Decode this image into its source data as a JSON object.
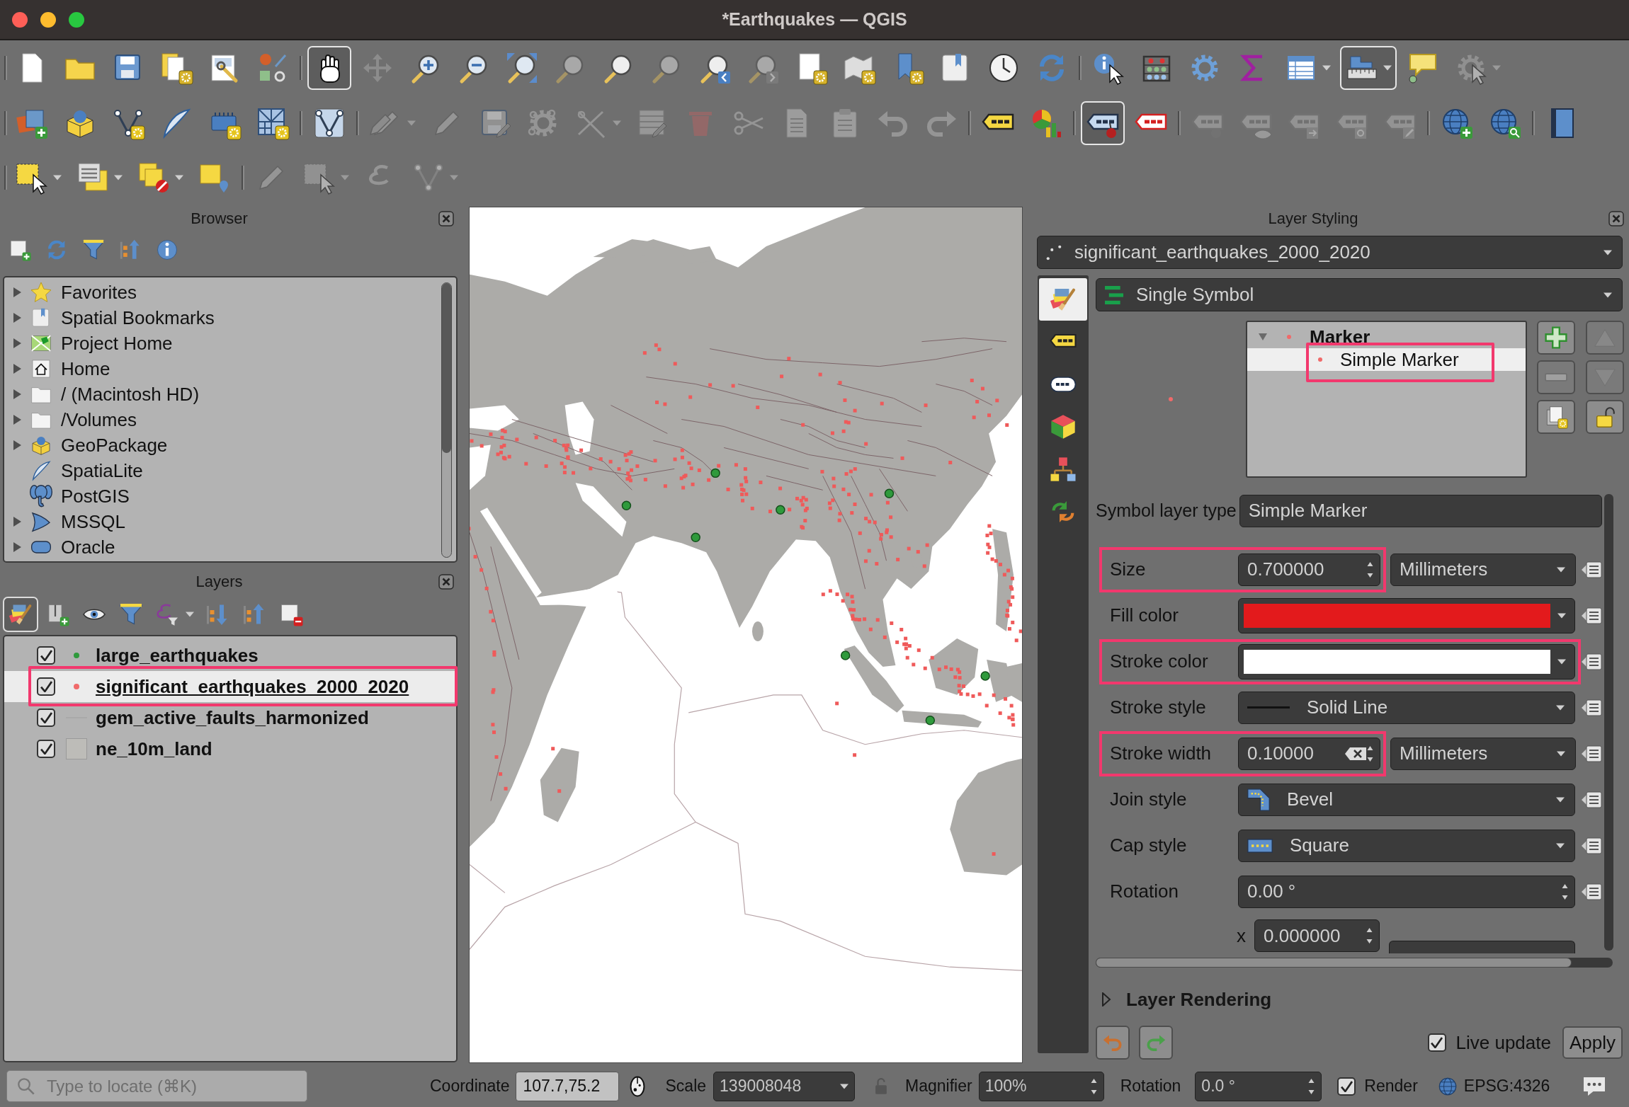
{
  "window": {
    "title": "*Earthquakes — QGIS"
  },
  "toolbars": [
    [
      [
        {
          "pressed": false,
          "disabled": false,
          "dropdown": false
        },
        {
          "pressed": false,
          "disabled": false,
          "dropdown": false
        },
        {
          "pressed": false,
          "disabled": false,
          "dropdown": false
        },
        {
          "pressed": false,
          "disabled": false,
          "dropdown": false
        },
        {
          "pressed": false,
          "disabled": false,
          "dropdown": false
        },
        {
          "pressed": false,
          "disabled": false,
          "dropdown": false
        }
      ],
      [
        {
          "pressed": true,
          "disabled": false,
          "dropdown": false
        },
        {
          "pressed": false,
          "disabled": true,
          "dropdown": false
        },
        {
          "pressed": false,
          "disabled": false,
          "dropdown": false
        },
        {
          "pressed": false,
          "disabled": false,
          "dropdown": false
        },
        {
          "pressed": false,
          "disabled": false,
          "dropdown": false
        },
        {
          "pressed": false,
          "disabled": true,
          "dropdown": false
        },
        {
          "pressed": false,
          "disabled": false,
          "dropdown": false
        },
        {
          "pressed": false,
          "disabled": true,
          "dropdown": false
        },
        {
          "pressed": false,
          "disabled": false,
          "dropdown": false
        },
        {
          "pressed": false,
          "disabled": true,
          "dropdown": false
        },
        {
          "pressed": false,
          "disabled": false,
          "dropdown": false
        },
        {
          "pressed": false,
          "disabled": false,
          "dropdown": false
        },
        {
          "pressed": false,
          "disabled": false,
          "dropdown": false
        },
        {
          "pressed": false,
          "disabled": false,
          "dropdown": false
        },
        {
          "pressed": false,
          "disabled": false,
          "dropdown": false
        },
        {
          "pressed": false,
          "disabled": false,
          "dropdown": false
        }
      ],
      [
        {
          "pressed": false,
          "disabled": false,
          "dropdown": false
        },
        {
          "pressed": false,
          "disabled": false,
          "dropdown": false
        },
        {
          "pressed": false,
          "disabled": false,
          "dropdown": false
        },
        {
          "pressed": false,
          "disabled": false,
          "dropdown": false
        },
        {
          "pressed": false,
          "disabled": false,
          "dropdown": true
        },
        {
          "pressed": true,
          "disabled": false,
          "dropdown": true
        },
        {
          "pressed": false,
          "disabled": false,
          "dropdown": false
        },
        {
          "pressed": false,
          "disabled": true,
          "dropdown": true
        }
      ]
    ],
    [
      [
        {
          "pressed": false,
          "disabled": false,
          "dropdown": false
        },
        {
          "pressed": false,
          "disabled": false,
          "dropdown": false
        },
        {
          "pressed": false,
          "disabled": false,
          "dropdown": false
        },
        {
          "pressed": false,
          "disabled": false,
          "dropdown": false
        },
        {
          "pressed": false,
          "disabled": false,
          "dropdown": false
        },
        {
          "pressed": false,
          "disabled": false,
          "dropdown": false
        }
      ],
      [
        {
          "pressed": false,
          "disabled": false,
          "dropdown": false
        }
      ],
      [
        {
          "pressed": false,
          "disabled": true,
          "dropdown": true
        },
        {
          "pressed": false,
          "disabled": true,
          "dropdown": false
        },
        {
          "pressed": false,
          "disabled": true,
          "dropdown": false
        },
        {
          "pressed": false,
          "disabled": true,
          "dropdown": false
        },
        {
          "pressed": false,
          "disabled": true,
          "dropdown": true
        },
        {
          "pressed": false,
          "disabled": true,
          "dropdown": false
        },
        {
          "pressed": false,
          "disabled": true,
          "dropdown": false
        },
        {
          "pressed": false,
          "disabled": true,
          "dropdown": false
        },
        {
          "pressed": false,
          "disabled": true,
          "dropdown": false
        },
        {
          "pressed": false,
          "disabled": true,
          "dropdown": false
        },
        {
          "pressed": false,
          "disabled": true,
          "dropdown": false
        },
        {
          "pressed": false,
          "disabled": true,
          "dropdown": false
        }
      ],
      [
        {
          "pressed": false,
          "disabled": false,
          "dropdown": false
        },
        {
          "pressed": false,
          "disabled": false,
          "dropdown": false
        }
      ],
      [
        {
          "pressed": true,
          "disabled": false,
          "dropdown": false
        },
        {
          "pressed": false,
          "disabled": false,
          "dropdown": false
        }
      ],
      [
        {
          "pressed": false,
          "disabled": true,
          "dropdown": false
        },
        {
          "pressed": false,
          "disabled": true,
          "dropdown": false
        },
        {
          "pressed": false,
          "disabled": true,
          "dropdown": false
        },
        {
          "pressed": false,
          "disabled": true,
          "dropdown": false
        },
        {
          "pressed": false,
          "disabled": true,
          "dropdown": false
        }
      ],
      [
        {
          "pressed": false,
          "disabled": false,
          "dropdown": false
        },
        {
          "pressed": false,
          "disabled": false,
          "dropdown": false
        }
      ],
      [
        {
          "pressed": false,
          "disabled": false,
          "dropdown": false
        }
      ]
    ],
    [
      [
        {
          "pressed": false,
          "disabled": false,
          "dropdown": true
        },
        {
          "pressed": false,
          "disabled": false,
          "dropdown": true
        },
        {
          "pressed": false,
          "disabled": false,
          "dropdown": true
        },
        {
          "pressed": false,
          "disabled": false,
          "dropdown": false
        }
      ],
      [
        {
          "pressed": false,
          "disabled": true,
          "dropdown": false
        },
        {
          "pressed": false,
          "disabled": true,
          "dropdown": true
        },
        {
          "pressed": false,
          "disabled": true,
          "dropdown": false
        },
        {
          "pressed": false,
          "disabled": true,
          "dropdown": true
        }
      ]
    ]
  ],
  "browser": {
    "title": "Browser",
    "items": [
      {
        "label": "Favorites",
        "expandable": true
      },
      {
        "label": "Spatial Bookmarks",
        "expandable": true
      },
      {
        "label": "Project Home",
        "expandable": true
      },
      {
        "label": "Home",
        "expandable": true
      },
      {
        "label": "/ (Macintosh HD)",
        "expandable": true
      },
      {
        "label": "/Volumes",
        "expandable": true
      },
      {
        "label": "GeoPackage",
        "expandable": true
      },
      {
        "label": "SpatiaLite",
        "expandable": false
      },
      {
        "label": "PostGIS",
        "expandable": false
      },
      {
        "label": "MSSQL",
        "expandable": true
      },
      {
        "label": "Oracle",
        "expandable": true
      }
    ]
  },
  "layers": {
    "title": "Layers",
    "toolbar": [
      {
        "pressed": true,
        "dropdown": false
      },
      {
        "pressed": false,
        "dropdown": false
      },
      {
        "pressed": false,
        "dropdown": false
      },
      {
        "pressed": false,
        "dropdown": false
      },
      {
        "pressed": false,
        "dropdown": true
      },
      {
        "pressed": false,
        "dropdown": false
      },
      {
        "pressed": false,
        "dropdown": false
      },
      {
        "pressed": false,
        "dropdown": false
      }
    ],
    "items": [
      {
        "name": "large_earthquakes",
        "checked": true,
        "selected": false,
        "highlighted": false,
        "kind": "point",
        "color": "#2f9a3c"
      },
      {
        "name": "significant_earthquakes_2000_2020",
        "checked": true,
        "selected": true,
        "highlighted": true,
        "kind": "point",
        "color": "#f06a6a"
      },
      {
        "name": "gem_active_faults_harmonized",
        "checked": true,
        "selected": false,
        "highlighted": false,
        "kind": "line",
        "color": "#a9a9a9"
      },
      {
        "name": "ne_10m_land",
        "checked": true,
        "selected": false,
        "highlighted": false,
        "kind": "polygon",
        "color": "#bdbcb8"
      }
    ]
  },
  "layer_styling": {
    "title": "Layer Styling",
    "layer": "significant_earthquakes_2000_2020",
    "tabs": [
      {
        "selected": true
      },
      {
        "selected": false
      },
      {
        "selected": false
      },
      {
        "selected": false
      },
      {
        "selected": false
      },
      {
        "selected": false
      }
    ],
    "renderer": "Single Symbol",
    "symbol_tree": {
      "label": "Marker",
      "expanded": true,
      "children": [
        {
          "label": "Simple Marker",
          "selected": true,
          "highlighted": true
        }
      ]
    },
    "symbol_buttons": [
      {
        "disabled": false
      },
      {
        "disabled": true
      },
      {
        "disabled": true
      },
      {
        "disabled": true
      },
      {
        "disabled": false
      },
      {
        "disabled": false
      }
    ],
    "symbol_layer_type": {
      "label": "Symbol layer type",
      "value": "Simple Marker"
    },
    "properties": [
      {
        "label": "Size",
        "kind": "spin",
        "value": "0.700000",
        "unit": "Millimeters",
        "clearable": false,
        "highlighted": true
      },
      {
        "label": "Fill color",
        "kind": "color",
        "color": "#e31a1c",
        "highlighted": false
      },
      {
        "label": "Stroke color",
        "kind": "color",
        "color": "#ffffff",
        "highlighted": true
      },
      {
        "label": "Stroke style",
        "kind": "combo",
        "value": "Solid Line",
        "highlighted": false
      },
      {
        "label": "Stroke width",
        "kind": "spin",
        "value": "0.10000",
        "unit": "Millimeters",
        "clearable": true,
        "highlighted": true
      },
      {
        "label": "Join style",
        "kind": "combo",
        "value": "Bevel",
        "highlighted": false
      },
      {
        "label": "Cap style",
        "kind": "combo",
        "value": "Square",
        "highlighted": false
      },
      {
        "label": "Rotation",
        "kind": "spin",
        "value": "0.00 °",
        "clearable": false,
        "highlighted": false
      }
    ],
    "offset": {
      "axis": "x",
      "value": "0.000000"
    },
    "layer_rendering": {
      "label": "Layer Rendering",
      "expanded": false
    },
    "live_update": {
      "label": "Live update",
      "checked": true
    },
    "apply": "Apply"
  },
  "status_bar": {
    "search": {
      "placeholder": "Type to locate (⌘K)"
    },
    "coordinate": {
      "label": "Coordinate",
      "value": "107.7,75.2"
    },
    "scale": {
      "label": "Scale",
      "value": "139008048"
    },
    "magnifier": {
      "label": "Magnifier",
      "value": "100%"
    },
    "rotation": {
      "label": "Rotation",
      "value": "0.0 °"
    },
    "render": {
      "label": "Render",
      "checked": true
    },
    "crs": "EPSG:4326"
  }
}
